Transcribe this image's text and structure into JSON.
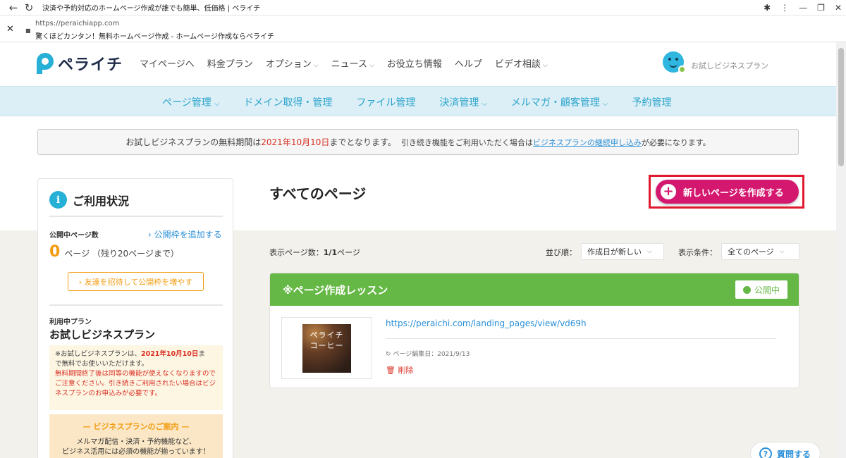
{
  "browser": {
    "tab_title": "決済や予約対応のホームページ作成が誰でも簡単、低価格 | ペライチ",
    "url": "https://peraichiapp.com",
    "page_title": "驚くほどカンタン！無料ホームページ作成 - ホームページ作成ならペライチ"
  },
  "header": {
    "logo_text": "ペライチ",
    "nav": [
      {
        "label": "マイページへ",
        "dropdown": false
      },
      {
        "label": "料金プラン",
        "dropdown": false
      },
      {
        "label": "オプション",
        "dropdown": true
      },
      {
        "label": "ニュース",
        "dropdown": true
      },
      {
        "label": "お役立ち情報",
        "dropdown": false
      },
      {
        "label": "ヘルプ",
        "dropdown": false
      },
      {
        "label": "ビデオ相談",
        "dropdown": true
      }
    ],
    "user_plan": "お試しビジネスプラン"
  },
  "subnav": {
    "items": [
      {
        "label": "ページ管理",
        "dropdown": true
      },
      {
        "label": "ドメイン取得・管理",
        "dropdown": false
      },
      {
        "label": "ファイル管理",
        "dropdown": false
      },
      {
        "label": "決済管理",
        "dropdown": true
      },
      {
        "label": "メルマガ・顧客管理",
        "dropdown": true
      },
      {
        "label": "予約管理",
        "dropdown": false
      }
    ]
  },
  "notice": {
    "prefix": "お試しビジネスプランの無料期間は",
    "date": "2021年10月10日",
    "middle": "までとなります。",
    "continue_text": "引き続き機能をご利用いただく場合は",
    "link": "ビジネスプランの継続申し込み",
    "suffix": "が必要になります。"
  },
  "sidebar": {
    "title": "ご利用状況",
    "published_label": "公開中ページ数",
    "add_slot_link": "› 公開枠を追加する",
    "published_count": "0",
    "published_unit": "ページ （残り20ページまで）",
    "invite_button": "› 友達を招待して公開枠を増やす",
    "plan_label": "利用中プラン",
    "plan_name": "お試しビジネスプラン",
    "warning": {
      "line1_prefix": "※お試しビジネスプランは、",
      "line1_date": "2021年10月10日",
      "line1_suffix": "ま",
      "line2": "で無料でお使いいただけます。",
      "red_text": "無料期間終了後は同等の機能が使えなくなりますのでご注意ください。引き続きご利用されたい場合はビジネスプランのお申込みが必要です。"
    },
    "promo": {
      "title": "— ビジネスプランのご案内 —",
      "line1": "メルマガ配信・決済・予約機能など、",
      "line2": "ビジネス活用には必須の機能が揃っています！"
    }
  },
  "main": {
    "title": "すべてのページ",
    "new_page_button": "新しいページを作成する",
    "page_count_prefix": "表示ページ数：",
    "page_count_value": "1/1",
    "page_count_suffix": "ページ",
    "sort_label": "並び順：",
    "sort_value": "作成日が新しい",
    "filter_label": "表示条件：",
    "filter_value": "全てのページ"
  },
  "page_card": {
    "title": "※ページ作成レッスン",
    "status": "公開中",
    "thumbnail_title_line1": "ペライチ",
    "thumbnail_title_line2": "コーヒー",
    "thumbnail_caption": "",
    "url": "https://peraichi.com/landing_pages/view/vd69h",
    "edit_date": "ページ編集日：2021/9/13",
    "delete_label": "削除"
  },
  "help": {
    "label": "質問する"
  },
  "colors": {
    "brand_blue": "#27b0d6",
    "cta_pink": "#d4186f",
    "highlight_red": "#e0192f",
    "card_green": "#65b845",
    "accent_orange": "#f39c12"
  }
}
